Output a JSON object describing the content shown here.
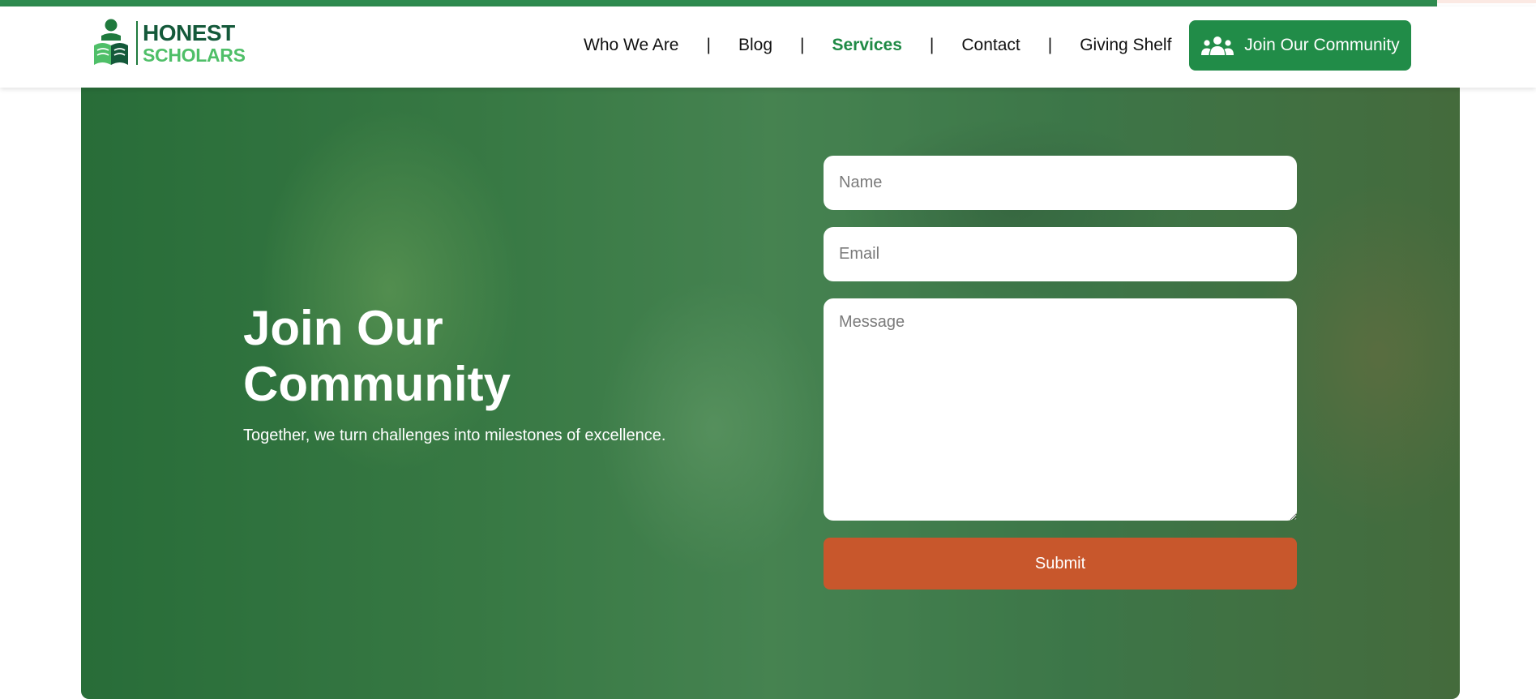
{
  "brand": {
    "line1": "HONEST",
    "line2": "SCHOLARS",
    "primary_color": "#1f8a45",
    "dark_color": "#14593a"
  },
  "nav": {
    "items": [
      {
        "label": "Who We Are",
        "active": false
      },
      {
        "label": "Blog",
        "active": false
      },
      {
        "label": "Services",
        "active": true
      },
      {
        "label": "Contact",
        "active": false
      },
      {
        "label": "Giving Shelf",
        "active": false
      }
    ],
    "separator": "|",
    "cta": {
      "label": "Join Our Community",
      "icon": "users-icon"
    }
  },
  "hero": {
    "title": "Join Our Community",
    "subtitle": "Together, we turn challenges into milestones of excellence."
  },
  "form": {
    "name_placeholder": "Name",
    "email_placeholder": "Email",
    "message_placeholder": "Message",
    "submit_label": "Submit",
    "submit_color": "#c8572c"
  }
}
